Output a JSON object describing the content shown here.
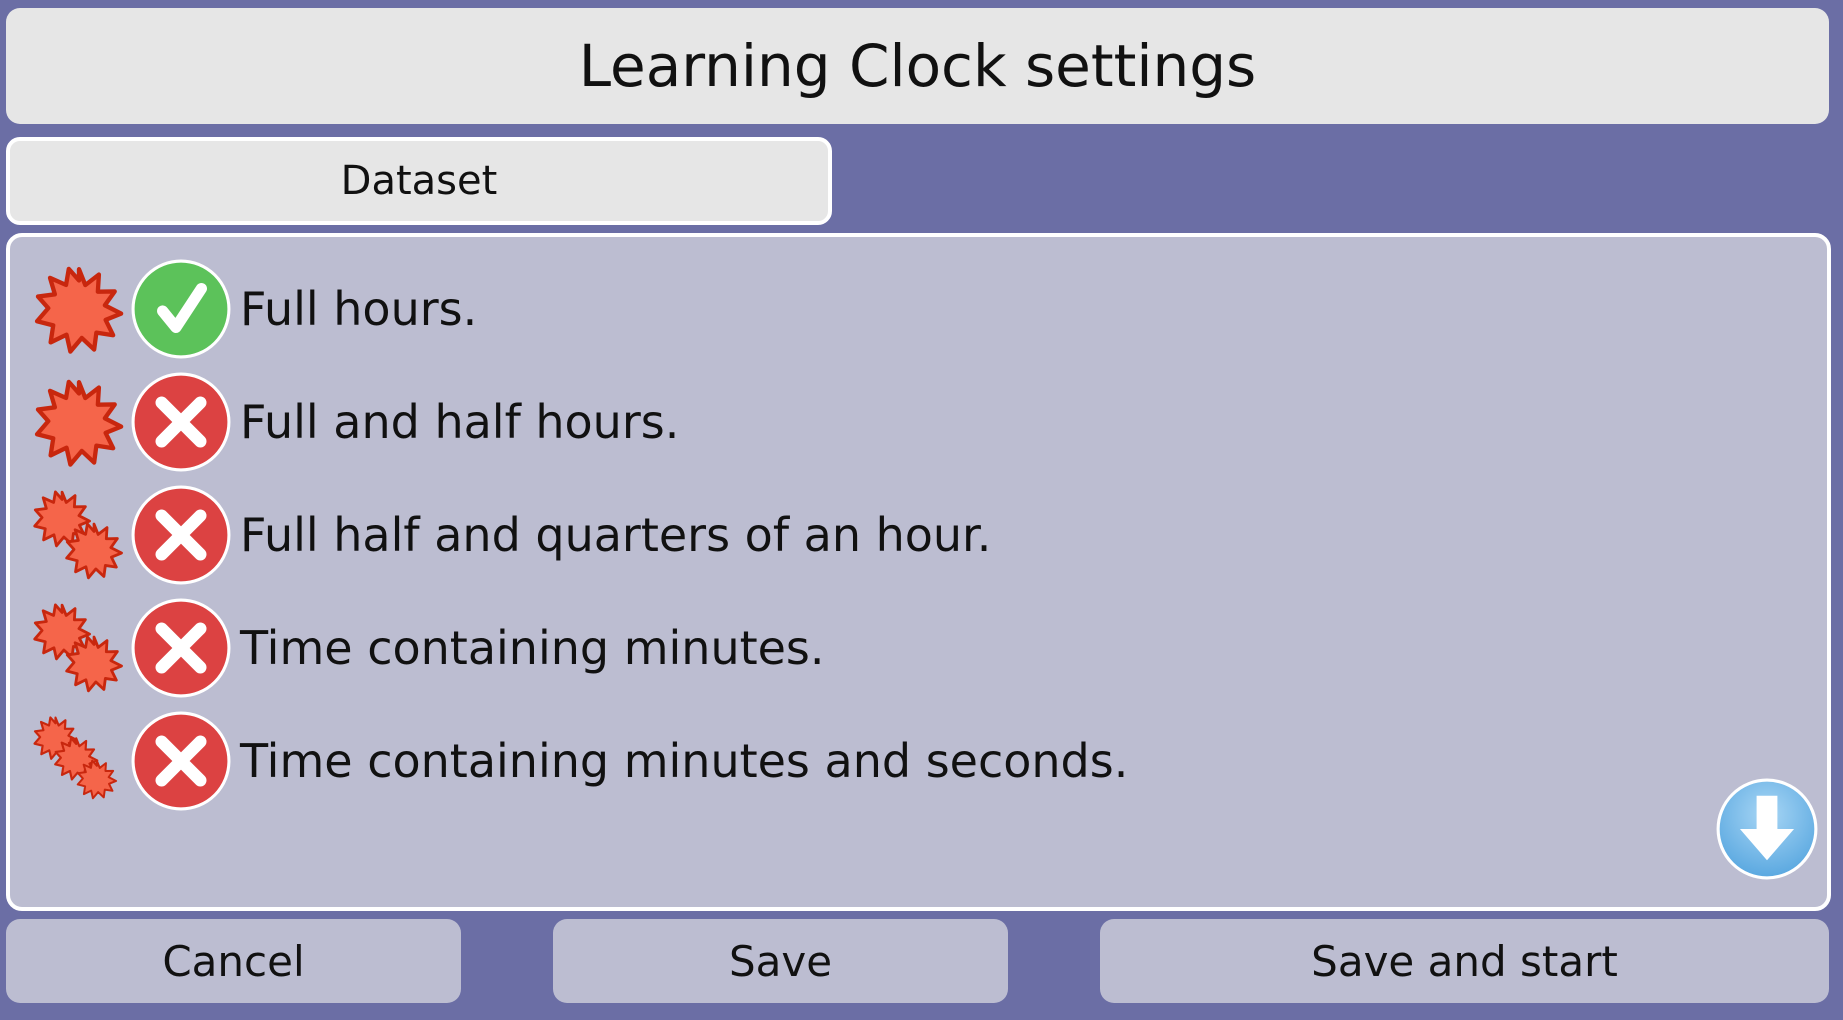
{
  "header": {
    "title": "Learning Clock settings"
  },
  "tabs": [
    {
      "label": "Dataset"
    }
  ],
  "dataset": {
    "items": [
      {
        "label": "Full hours.",
        "level_icon": "single-star-icon",
        "status_icon": "check-icon",
        "selected": true
      },
      {
        "label": "Full and half hours.",
        "level_icon": "single-star-icon",
        "status_icon": "cross-icon",
        "selected": false
      },
      {
        "label": "Full half and quarters of an hour.",
        "level_icon": "double-star-icon",
        "status_icon": "cross-icon",
        "selected": false
      },
      {
        "label": "Time containing minutes.",
        "level_icon": "double-star-icon",
        "status_icon": "cross-icon",
        "selected": false
      },
      {
        "label": "Time containing minutes and seconds.",
        "level_icon": "triple-star-icon",
        "status_icon": "cross-icon",
        "selected": false
      }
    ],
    "scroll_icon": "arrow-down-icon"
  },
  "footer": {
    "cancel_label": "Cancel",
    "save_label": "Save",
    "save_start_label": "Save and start"
  },
  "colors": {
    "background": "#6b6ea5",
    "panel": "#bcbdd1",
    "bar": "#e6e6e6",
    "check_green": "#5cc25a",
    "cross_red": "#dc4242",
    "star_fill": "#f5654a",
    "star_stroke": "#c8270e",
    "scroll_blue": "#6cb4e8"
  }
}
